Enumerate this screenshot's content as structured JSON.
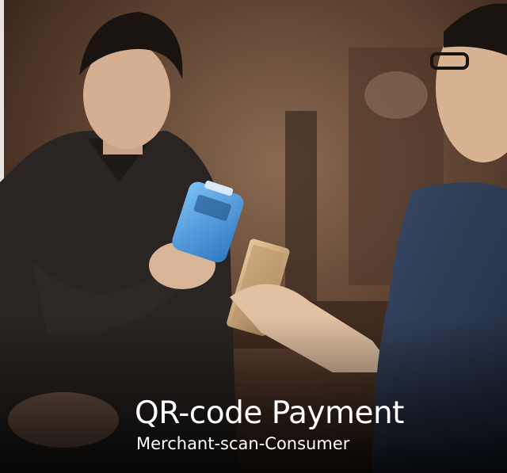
{
  "caption": {
    "title": "QR-code Payment",
    "subtitle": "Merchant-scan-Consumer"
  },
  "colors": {
    "background_warm": "#6b4a35",
    "shirt_dark": "#2a2522",
    "terminal_blue": "#4a9ae0",
    "phone_gold": "#c9a478",
    "caption_text": "#ffffff"
  }
}
